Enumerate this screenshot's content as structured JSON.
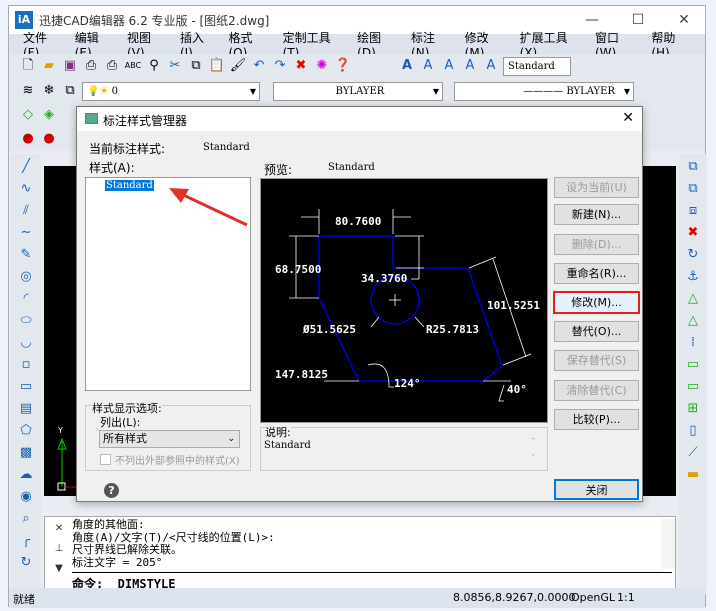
{
  "window": {
    "title": "迅捷CAD编辑器 6.2 专业版  - [图纸2.dwg]",
    "logo": "iA",
    "minimize": "—",
    "maximize": "☐",
    "close": "✕"
  },
  "menu": [
    "文件(F)",
    "编辑(E)",
    "视图(V)",
    "插入(I)",
    "格式(O)",
    "定制工具(T)",
    "绘图(D)",
    "标注(N)",
    "修改(M)",
    "扩展工具(X)",
    "窗口(W)",
    "帮助(H)"
  ],
  "toolbar": {
    "text_style": "Standard",
    "layer": "0",
    "color": "BYLAYER",
    "linetype": "BYLAYER"
  },
  "dialog": {
    "title": "标注样式管理器",
    "current_label": "当前标注样式:",
    "current_value": "Standard",
    "styles_label": "样式(A):",
    "styles": [
      "Standard"
    ],
    "preview_label": "预览:",
    "preview_value": "Standard",
    "preview_dims": {
      "top": "80.7600",
      "left": "68.7500",
      "notch": "34.3760",
      "right": "101.5251",
      "diameter": "Ø51.5625",
      "radius": "R25.7813",
      "bottom": "147.8125",
      "angle1": "124°",
      "angle2": "40°"
    },
    "display_group": "样式显示选项:",
    "list_label": "列出(L):",
    "list_value": "所有样式",
    "exclude_xref": "不列出外部参照中的样式(X)",
    "desc_label": "说明:",
    "desc_value": "Standard",
    "buttons": {
      "set_current": "设为当前(U)",
      "new": "新建(N)...",
      "delete": "删除(D)...",
      "rename": "重命名(R)...",
      "modify": "修改(M)...",
      "override": "替代(O)...",
      "save_override": "保存替代(S)",
      "clear_override": "清除替代(C)",
      "compare": "比较(P)...",
      "close": "关闭"
    },
    "close_icon": "✕",
    "help": "?"
  },
  "command": {
    "history": [
      "角度的其他面:",
      "角度(A)/文字(T)/<尺寸线的位置(L)>:",
      "尺寸界线已解除关联。",
      "标注文字 = 205°"
    ],
    "prompt": "命令:  _DIMSTYLE"
  },
  "status": {
    "text": "就绪",
    "coords": "8.0856,8.9267,0.0000",
    "renderer": "OpenGL",
    "scale": "1:1"
  },
  "colors": {
    "accent": "#0078d7",
    "highlight": "#e02020",
    "preview_lines": "#0000ff"
  }
}
